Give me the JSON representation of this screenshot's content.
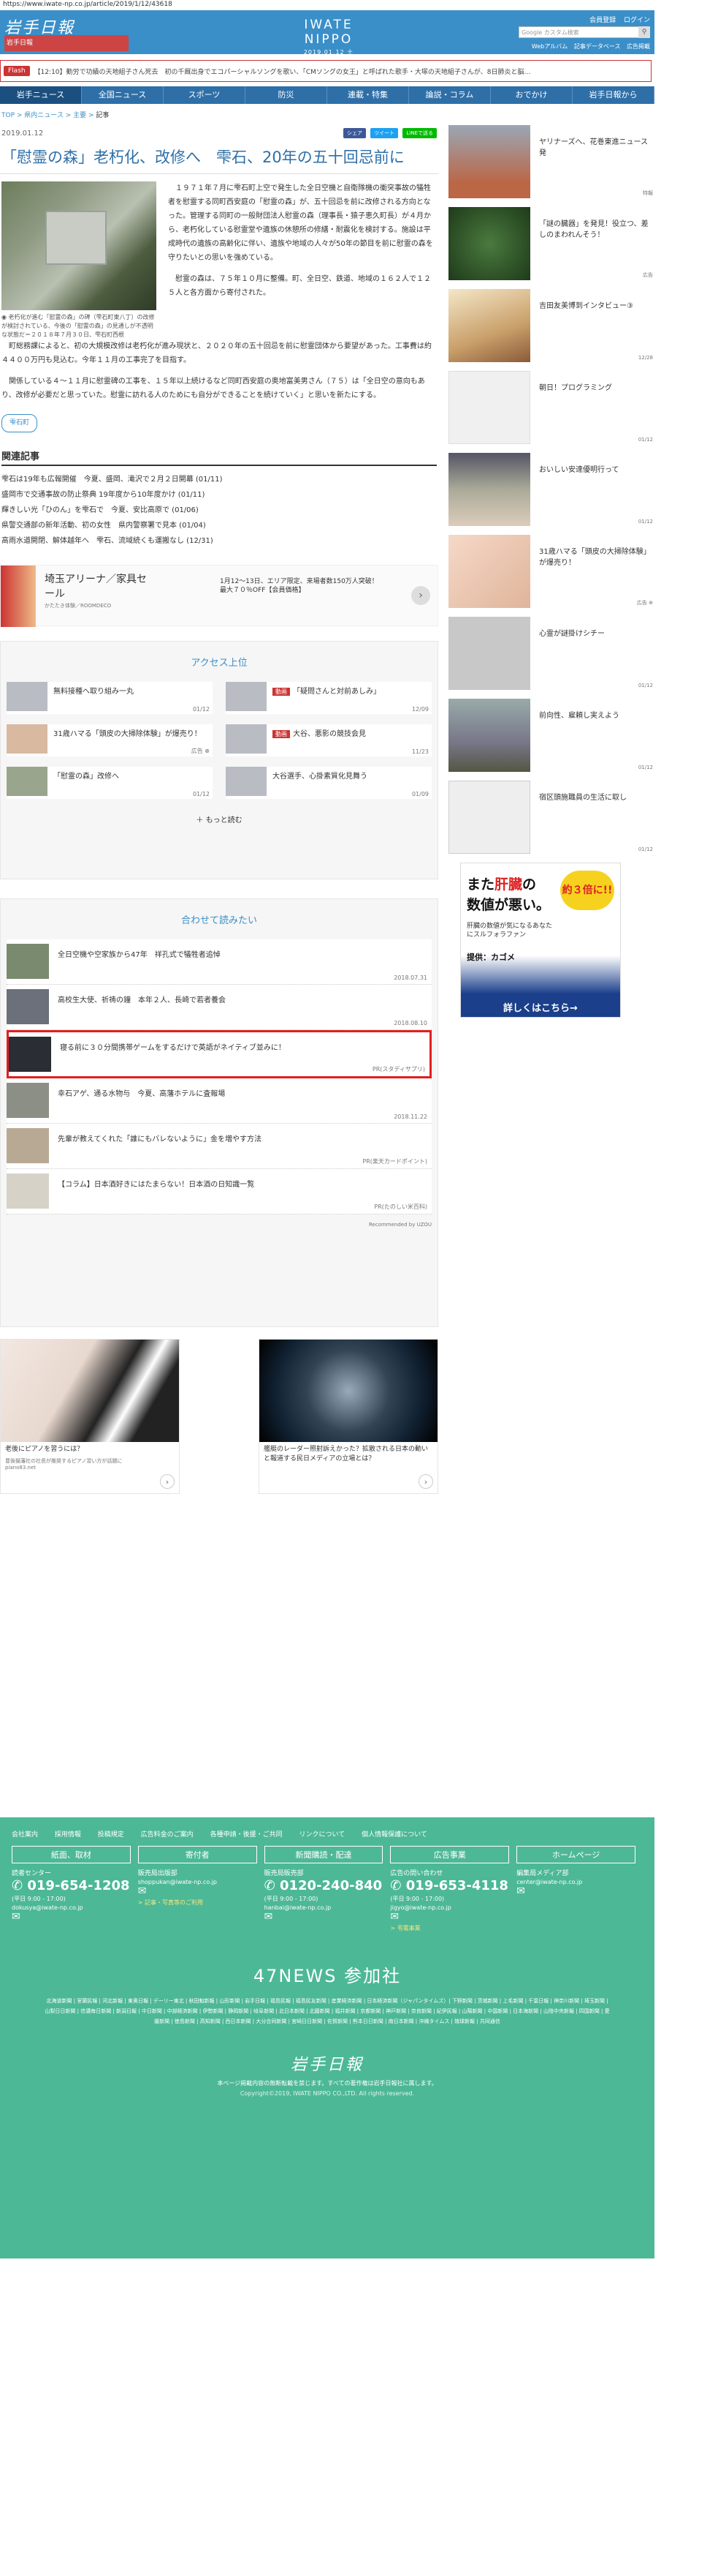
{
  "browser": {
    "url": "https://www.iwate-np.co.jp/article/2019/1/12/43618"
  },
  "header": {
    "logo": "岩手日報",
    "brand": "IWATE NIPPO",
    "date": "2019.01.12 土",
    "links": [
      "会員登録",
      "ログイン"
    ],
    "search_placeholder": "Google カスタム検索",
    "sublinks": [
      "Webアルバム",
      "記事データベース",
      "広告掲載"
    ],
    "banner": "岩手日報 "
  },
  "flash": {
    "label": "Flash",
    "text": "【12:10】勤労で功績の天地組子さん死去　初の千厩出身でエコパーシャルソングを歌い、「CMソングの女王」と呼ばれた歌手・大塚の天地組子さんが、8日肺炎と脳…"
  },
  "nav": [
    "岩手ニュース",
    "全国ニュース",
    "スポーツ",
    "防災",
    "連載・特集",
    "論説・コラム",
    "おでかけ",
    "岩手日報から"
  ],
  "breadcrumb": {
    "items": [
      "TOP",
      "県内ニュース",
      "主要"
    ],
    "current": "記事"
  },
  "article": {
    "date": "2019.01.12",
    "shares": [
      "シェア",
      "ツイート",
      "LINEで送る"
    ],
    "title": "「慰霊の森」老朽化、改修へ　雫石、20年の五十回忌前に",
    "caption": "老朽化が進む「慰霊の森」の碑（雫石町東八丁）の改修が検討されている、今後の「慰霊の森」の見通しが不透明な状態だ＝２０１８年７月３０日、雫石町西根",
    "p1": "１９７１年７月に雫石町上空で発生した全日空機と自衛隊機の衝突事故の犠牲者を慰霊する同町西安庭の「慰霊の森」が、五十回忌を前に改修される方向となった。管理する同町の一般財団法人慰霊の森（理事長・猿子恵久町長）が４月から、老朽化している慰霊堂や遺族の休憩所の修繕・耐震化を検討する。施設は平成時代の遺族の高齢化に伴い、遺族や地域の人々が50年の節目を前に慰霊の森を守りたいとの思いを強めている。",
    "p2": "慰霊の森は、７５年１０月に整備。町、全日空、鉄道、地域の１６２人で１２５人と各方面から寄付された。",
    "p3": "町総務課によると、初の大規模改修は老朽化が進み現状と、２０２０年の五十回忌を前に慰霊団体から要望があった。工事費は約４４００万円も見込む。今年１１月の工事完了を目指す。",
    "p4": "関係している４～１１月に慰霊碑の工事を、１５年以上続けるなど同町西安庭の奥地富美男さん（７５）は「全日空の意向もあり、改修が必要だと思っていた。慰霊に訪れる人のためにも自分ができることを続けていく」と思いを新たにする。",
    "tag": "雫石町"
  },
  "related": {
    "heading": "関連記事",
    "items": [
      "雫石は19年も広報開催　今夏、盛岡、滝沢で２月２日開幕 (01/11)",
      "盛岡市で交通事故の防止祭典 19年度から10年度かけ (01/11)",
      "輝きしい光「ひのん」を雫石で　今夏、安比高原で (01/06)",
      "県警交通部の新年活動、初の女性　県内警察署で見本 (01/04)",
      "高雨水道開閉、解体越年へ　雫石、流域続くも運搬なし (12/31)"
    ]
  },
  "ad1": {
    "title": "埼玉アリーナ／家具セール",
    "sponsor": "かたたき体験／ROOMDECO",
    "desc": "1月12〜13日、エリア限定、来場者数150万人突破！最大７０％OFF【会員価格】"
  },
  "access": {
    "heading": "アクセス上位",
    "items": [
      {
        "title": "無料接種へ取り組み一丸",
        "date": "01/12",
        "badge": ""
      },
      {
        "title": "「疑問さんと対前あしみ」",
        "date": "12/09",
        "badge": "動画"
      },
      {
        "title": "31歳ハマる「頭皮の大掃除体験」が爆売り！",
        "date": "広告 ⊕",
        "badge": ""
      },
      {
        "title": "大谷、悪影の競技会見",
        "date": "11/23",
        "badge": "動画"
      },
      {
        "title": "「慰霊の森」改修へ",
        "date": "01/12",
        "badge": ""
      },
      {
        "title": "大谷選手、心掛素質化見舞う",
        "date": "01/09",
        "badge": ""
      }
    ],
    "more": "＋ もっと読む"
  },
  "recommend": {
    "heading": "合わせて読みたい",
    "items": [
      {
        "title": "全日空機や空家族から47年　祥孔式で犠牲者追悼",
        "date": "2018.07.31"
      },
      {
        "title": "高校生大使、祈祷の鐘　本年２人、長崎で若者養会",
        "date": "2018.08.10"
      },
      {
        "title": "寝る前に３０分間携帯ゲームをするだけで英語がネイティブ並みに！",
        "date": "PR(スタディサプリ)"
      },
      {
        "title": "幸石アゲ、通る水物与　今夏、高藩ホテルに査報場",
        "date": "2018.11.22"
      },
      {
        "title": "先輩が教えてくれた「誰にもバレないように」金を増やす方法",
        "date": "PR(楽天カードポイント)"
      },
      {
        "title": "【コラム】日本酒好きにはたまらない！日本酒の日知識一覧",
        "date": "PR(たのしい米百科)"
      }
    ],
    "powered": "Recommended by  UZOU"
  },
  "bottom_ads": [
    {
      "caption": "老後にピアノを習うには？",
      "sub": "豊後猫藩社の社長が推奨するピアノ習い方が話題に",
      "src": "piano83.net"
    },
    {
      "caption": "艦艇のレーダー照射訴えかった？拡散される日本の動いと報道する民日メディアの立場とは？",
      "sub": "",
      "src": ""
    }
  ],
  "sidebar": {
    "items": [
      {
        "title": "ヤリナーズへ、花巻東進ニュース発",
        "date": "特報"
      },
      {
        "title": "「謎の臓器」を発見！役立つ、差しのまわれんそう！",
        "date": "広告"
      },
      {
        "title": "吉田友美博到インタビュー③",
        "date": "12/28"
      },
      {
        "title": "朝日！プログラミング",
        "date": "01/12"
      },
      {
        "title": "おいしい安達優明行って",
        "date": "01/12"
      },
      {
        "title": "31歳ハマる「頭皮の大掃除体験」が爆売り！",
        "date": "広告 ⊕"
      },
      {
        "title": "心霊が謎掛けシチー",
        "date": "01/12"
      },
      {
        "title": "前向性、雇頼し実えよう",
        "date": "01/12"
      },
      {
        "title": "宿区頭施職員の生活に取し",
        "date": "01/12"
      }
    ],
    "ad": {
      "line1a": "また",
      "line1b": "肝臓",
      "line1c": "の",
      "line2": "数値が悪い。",
      "burst": "約３倍に!!",
      "mid": "肝臓の数値が気になるあなたにスルフォラファン",
      "prod": "提供：カゴメ",
      "cta": "詳しくはこちら→"
    }
  },
  "footer": {
    "links": [
      "会社案内",
      "採用情報",
      "投稿規定",
      "広告料金のご案内",
      "各種申請・後援・ご共同",
      "リンクについて",
      "個人情報保護について"
    ],
    "columns": [
      {
        "head": "紙面、取材",
        "label": "読者センター",
        "tel": "019-654-1208",
        "hours": "(平日 9:00 - 17:00)",
        "mail": "dokusya@iwate-np.co.jp",
        "link": ""
      },
      {
        "head": "寄付者",
        "label": "販売局出版部",
        "tel": "",
        "hours": "",
        "mail": "shoppukan@iwate-np.co.jp",
        "link": "> 記事・写真等のご利用"
      },
      {
        "head": "新聞購読・配達",
        "label": "販売局販売部",
        "tel": "0120-240-840",
        "hours": "(平日 9:00 - 17:00)",
        "mail": "hanbai@iwate-np.co.jp",
        "link": ""
      },
      {
        "head": "広告事業",
        "label": "広告の問い合わせ",
        "tel": "019-653-4118",
        "hours": "(平日 9:00 - 17:00)",
        "mail": "jigyo@iwate-np.co.jp",
        "link": "> 弔電事業"
      },
      {
        "head": "ホームページ",
        "label": "編集局メディア部",
        "tel": "",
        "hours": "",
        "mail": "center@iwate-np.co.jp",
        "link": ""
      }
    ],
    "n47": "47NEWS 参加社",
    "papers": "北海道新聞 | 室蘭民報 | 河北新報 | 東奥日報 | デーリー東北 | 秋田魁新報 | 山形新聞 | 岩手日報 | 福島民報 | 福島民友新聞 | 産業経済新聞 | 日本経済新聞（ジャパンタイムズ）| 下野新聞 | 茨城新聞 | 上毛新聞 | 千葉日報 | 神奈川新聞 | 埼玉新聞 | 山梨日日新聞 | 信濃毎日新聞 | 新潟日報 | 中日新聞 | 中部経済新聞 | 伊勢新聞 | 静岡新聞 | 岐阜新聞 | 北日本新聞 | 北國新聞 | 福井新聞 | 京都新聞 | 神戸新聞 | 奈良新聞 | 紀伊民報 | 山陽新聞 | 中国新聞 | 日本海新聞 | 山陰中央新報 | 四国新聞 | 愛媛新聞 | 徳島新聞 | 高知新聞 | 西日本新聞 | 大分合同新聞 | 宮崎日日新聞 | 佐賀新聞 | 熊本日日新聞 | 南日本新聞 | 沖縄タイムス | 琉球新報 | 共同通信",
    "logo": "岩手日報",
    "note": "本ページ掲載内容の無断転載を禁じます。すべての著作権は岩手日報社に属します。",
    "copyright": "Copyright©2019, IWATE NIPPO CO.,LTD. All rights reserved."
  }
}
